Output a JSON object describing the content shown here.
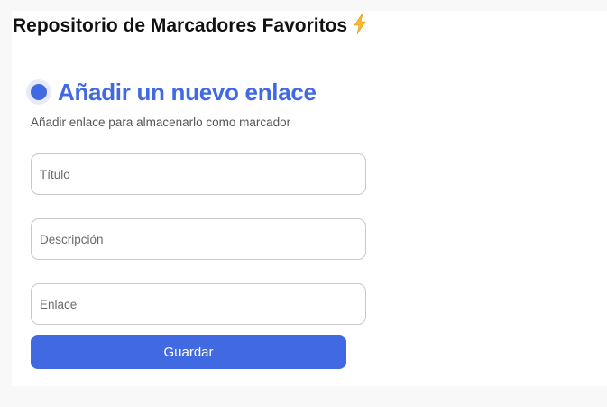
{
  "app": {
    "title": "Repositorio de Marcadores Favoritos",
    "title_icon": "lightning-bolt-icon"
  },
  "form": {
    "heading": "Añadir un nuevo enlace",
    "subtitle": "Añadir enlace para almacenarlo como marcador",
    "fields": {
      "title": {
        "placeholder": "Título",
        "value": ""
      },
      "description": {
        "placeholder": "Descripción",
        "value": ""
      },
      "link": {
        "placeholder": "Enlace",
        "value": ""
      }
    },
    "save_label": "Guardar"
  },
  "colors": {
    "accent": "#4169e1",
    "accent_light": "#e7ebf8",
    "bolt": "#f5b82e"
  }
}
